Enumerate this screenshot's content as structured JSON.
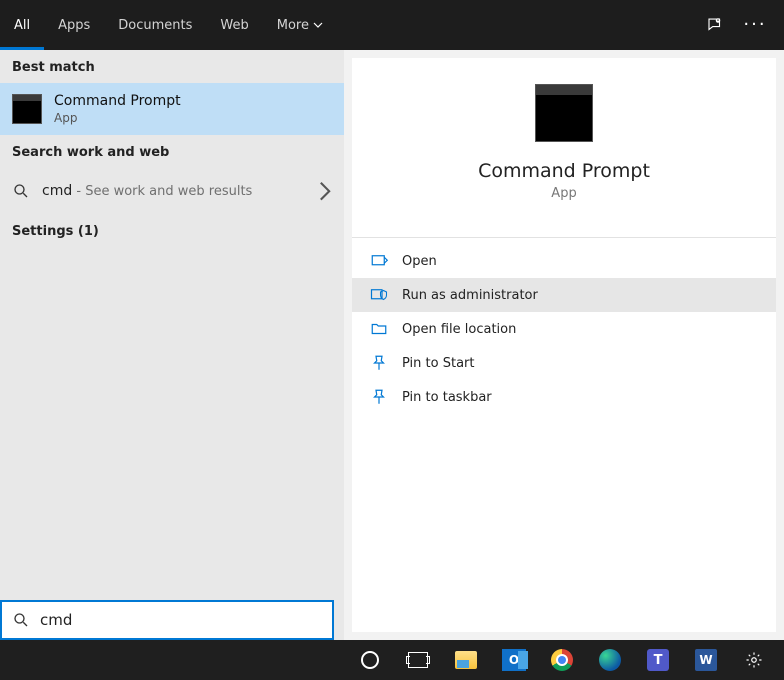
{
  "tabs": {
    "all": "All",
    "apps": "Apps",
    "documents": "Documents",
    "web": "Web",
    "more": "More"
  },
  "left": {
    "best_match_header": "Best match",
    "best": {
      "title": "Command Prompt",
      "sub": "App"
    },
    "search_web_header": "Search work and web",
    "web_query": "cmd",
    "web_hint": " - See work and web results",
    "settings_header": "Settings (1)"
  },
  "right": {
    "title": "Command Prompt",
    "sub": "App",
    "actions": {
      "open": "Open",
      "run_admin": "Run as administrator",
      "open_loc": "Open file location",
      "pin_start": "Pin to Start",
      "pin_taskbar": "Pin to taskbar"
    }
  },
  "search": {
    "value": "cmd"
  },
  "outlook_letter": "O",
  "teams_letter": "T",
  "word_letter": "W"
}
